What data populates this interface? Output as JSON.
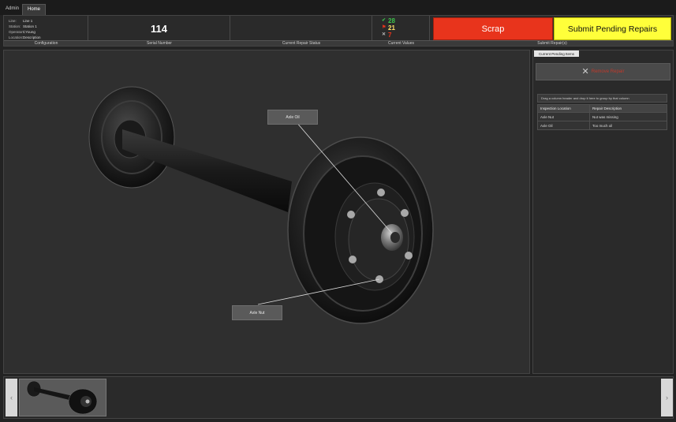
{
  "tabs": [
    {
      "label": "Admin"
    },
    {
      "label": "Home"
    }
  ],
  "config": {
    "caption": "Configuration",
    "rows": [
      {
        "key": "Line:",
        "value": "Line 1"
      },
      {
        "key": "Station:",
        "value": "Station 1"
      },
      {
        "key": "Operator:",
        "value": "CYoung"
      },
      {
        "key": "Location:",
        "value": "Description"
      }
    ]
  },
  "serial": {
    "value": "114",
    "caption": "Serial Number"
  },
  "repair_status": {
    "caption": "Current Repair Status"
  },
  "current_values": {
    "caption": "Current Values",
    "pass": "28",
    "flag": "21",
    "fail": "7",
    "colors": {
      "pass": "#3cc34a",
      "flag": "#ffe36a",
      "fail": "#e8341c"
    }
  },
  "actions": {
    "scrap_label": "Scrap",
    "submit_label": "Submit Pending Repairs",
    "submit_caption": "Submit Repair(s)",
    "scrap_color": "#e8341c",
    "submit_color": "#ffff3a"
  },
  "viewer": {
    "callouts": [
      {
        "label": "Axle Oil"
      },
      {
        "label": "Axle Nut"
      }
    ]
  },
  "pending": {
    "tab_label": "Current Pending Items",
    "remove_label": "Remove Repair",
    "group_hint": "Drag a column header and drop it here to group by that column",
    "columns": [
      "Inspection Location",
      "Repair Description"
    ],
    "rows": [
      [
        "Axle Nut",
        "Nut was missing"
      ],
      [
        "Axle Oil",
        "Too much oil"
      ]
    ]
  },
  "strip": {
    "prev_icon": "chevron-left-icon",
    "next_icon": "chevron-right-icon"
  }
}
